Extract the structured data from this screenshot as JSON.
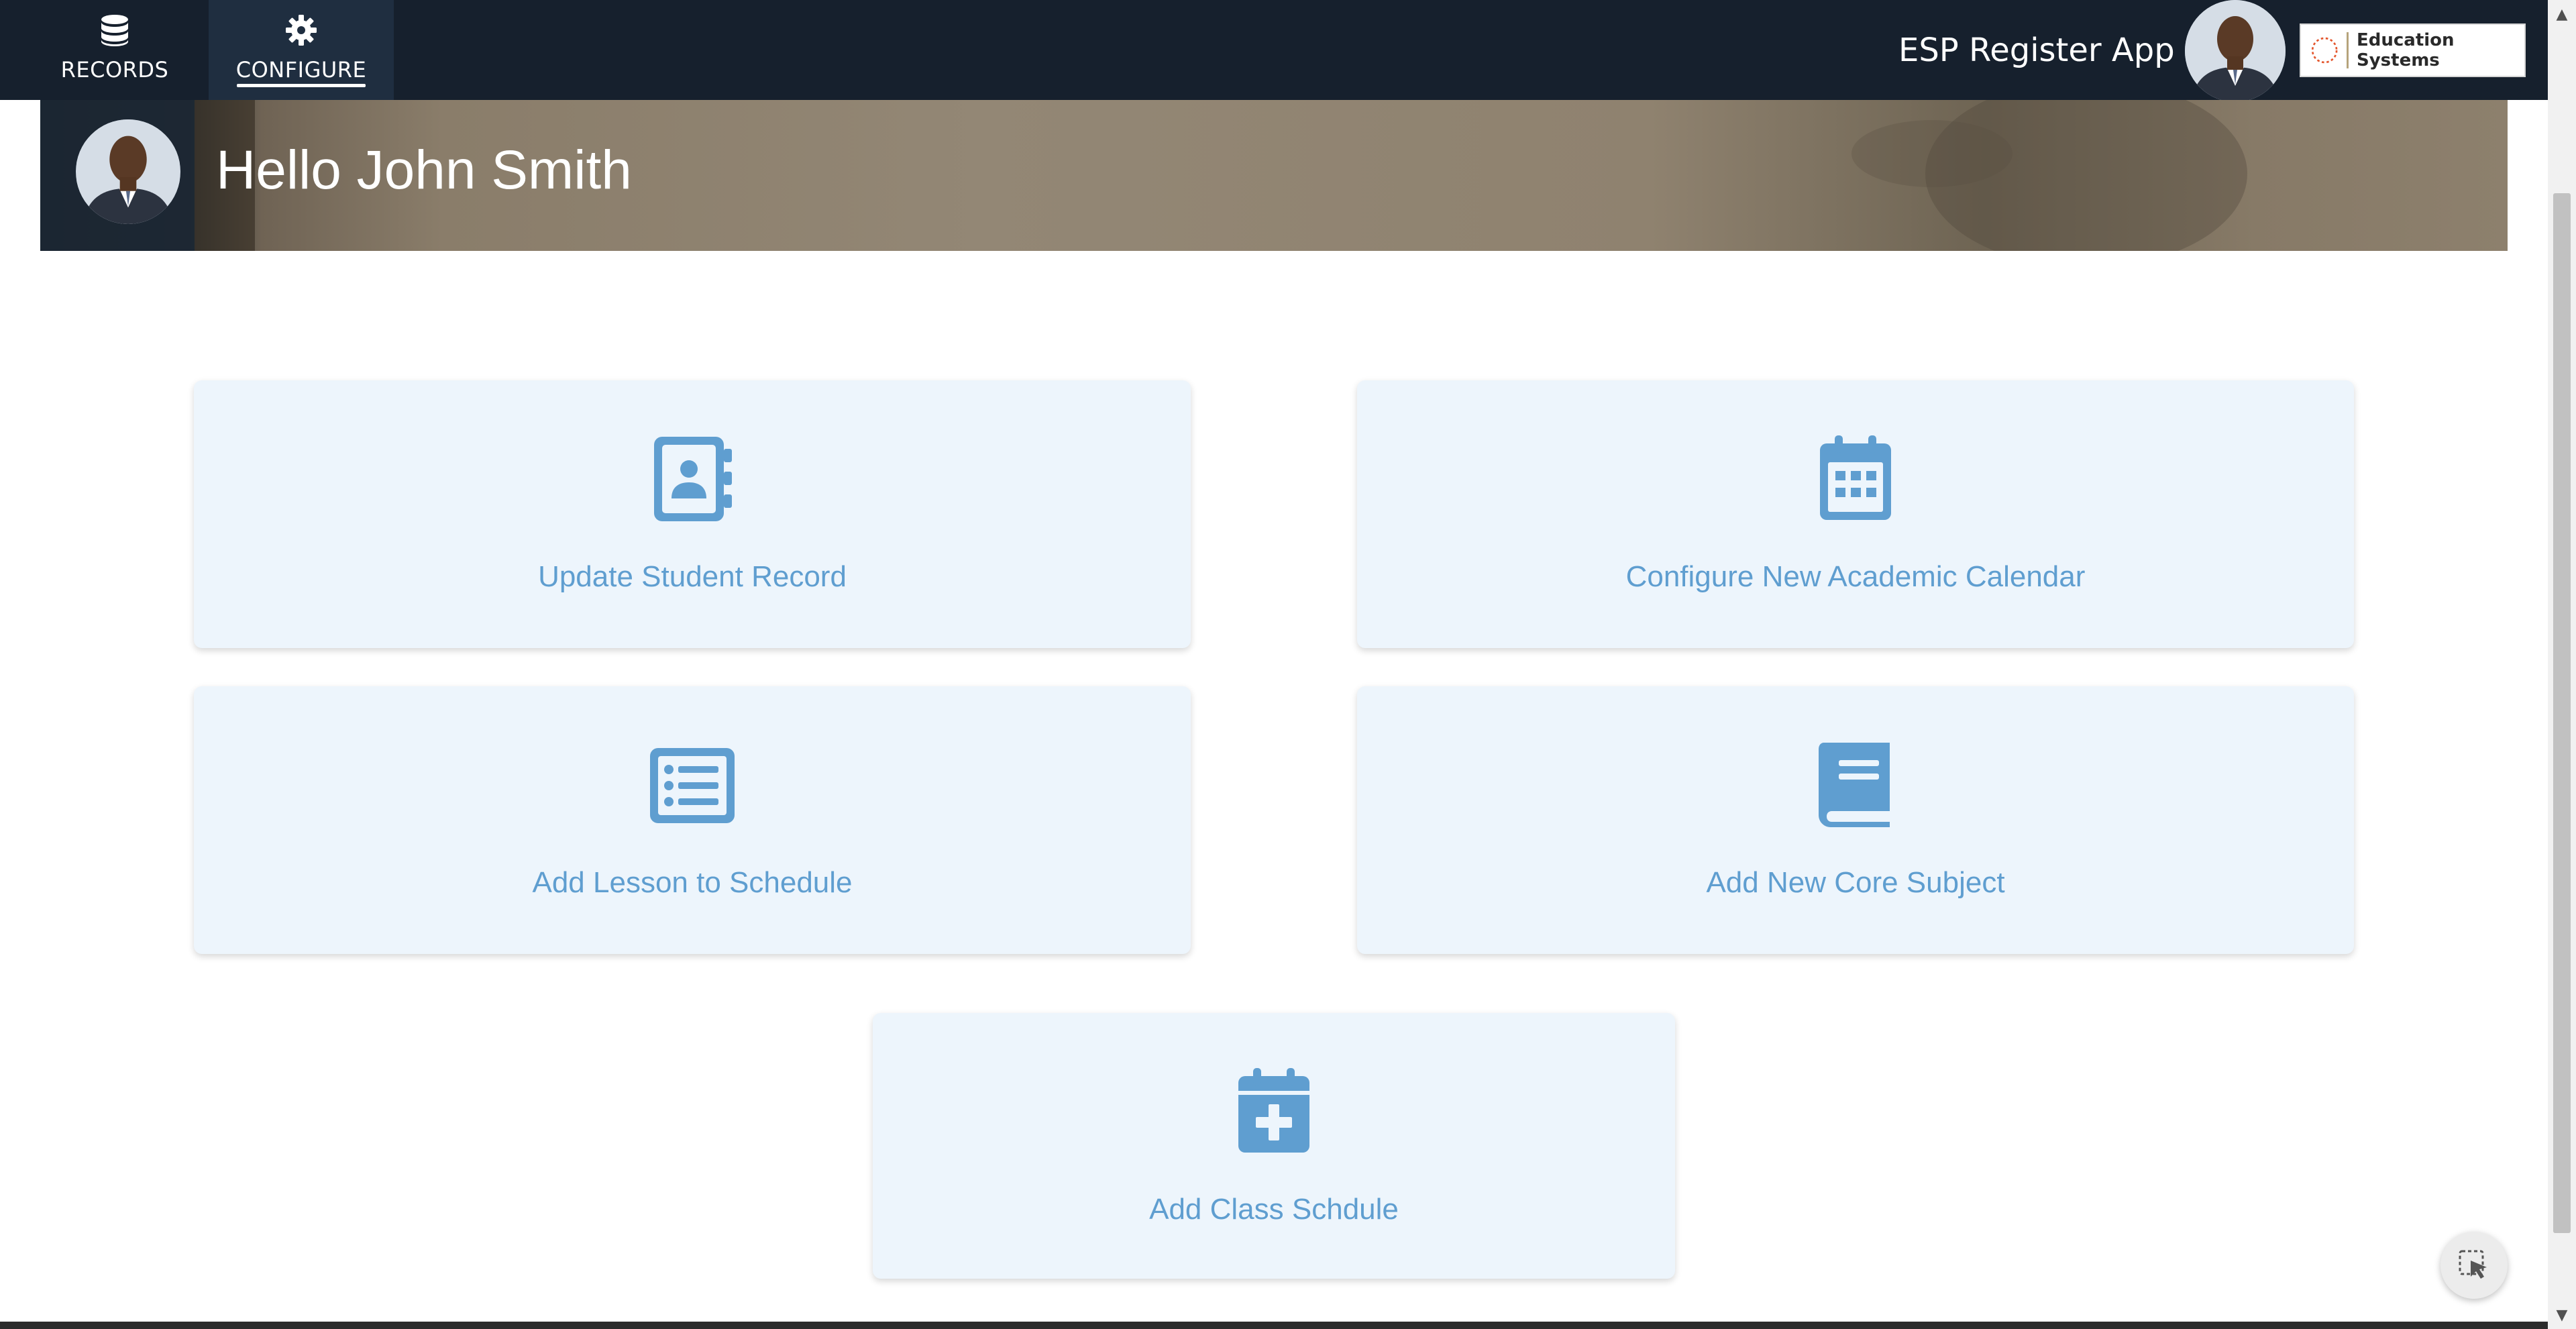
{
  "nav": {
    "records_label": "RECORDS",
    "configure_label": "CONFIGURE",
    "active": "configure",
    "app_name": "ESP Register App",
    "brand_name": "Education Systems"
  },
  "banner": {
    "greeting": "Hello John Smith"
  },
  "tiles": [
    {
      "label": "Update Student Record",
      "icon": "contact-book-icon"
    },
    {
      "label": "Configure New Academic Calendar",
      "icon": "calendar-icon"
    },
    {
      "label": "Add Lesson to Schedule",
      "icon": "list-icon"
    },
    {
      "label": "Add New Core Subject",
      "icon": "book-icon"
    },
    {
      "label": "Add Class Schdule",
      "icon": "calendar-plus-icon"
    }
  ],
  "colors": {
    "nav_background": "#16202d",
    "tile_background": "#edf5fc",
    "accent": "#5f9ed0"
  }
}
